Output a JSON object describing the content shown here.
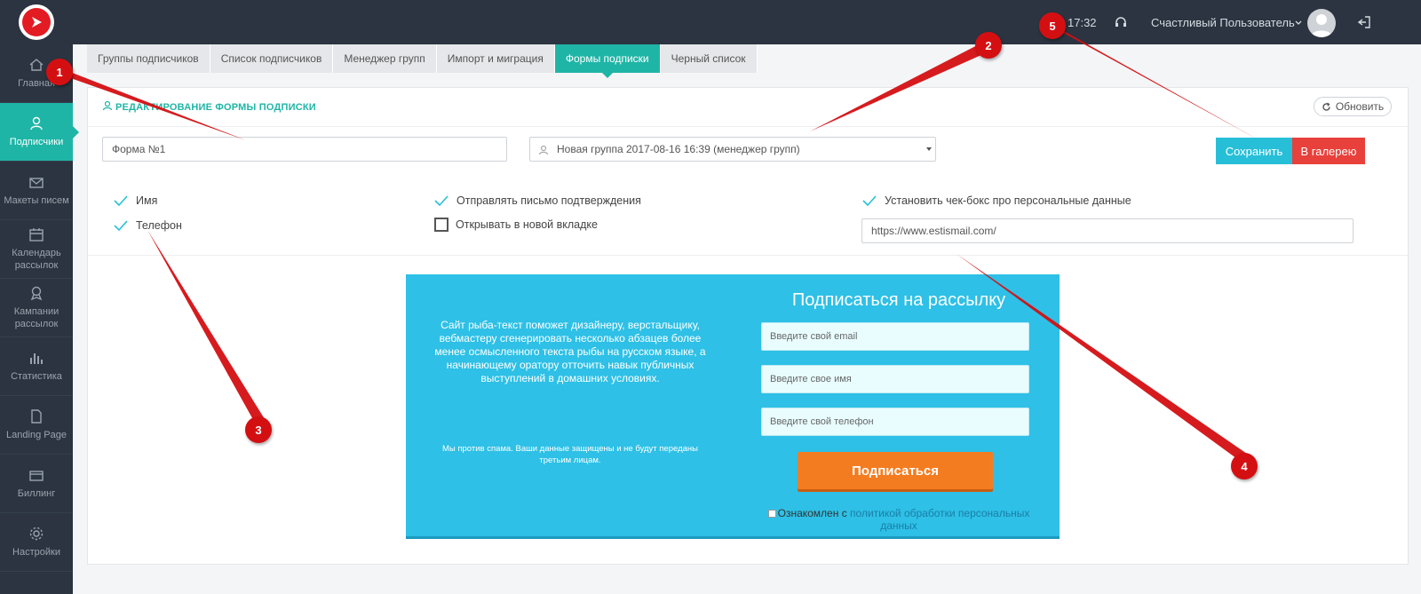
{
  "sidebar": {
    "items": [
      {
        "label": "Главная",
        "icon": "home-icon"
      },
      {
        "label": "Подписчики",
        "icon": "users-icon"
      },
      {
        "label": "Макеты писем",
        "icon": "envelope-icon"
      },
      {
        "label": "Календарь рассылок",
        "icon": "calendar-icon"
      },
      {
        "label": "Кампании рассылок",
        "icon": "campaign-icon"
      },
      {
        "label": "Статистика",
        "icon": "bar-chart-icon"
      },
      {
        "label": "Landing Page",
        "icon": "page-icon"
      },
      {
        "label": "Биллинг",
        "icon": "wallet-icon"
      },
      {
        "label": "Настройки",
        "icon": "gear-icon"
      }
    ]
  },
  "topbar": {
    "time": "17:32",
    "user_name": "Счастливый Пользователь"
  },
  "tabs": [
    {
      "label": "Группы подписчиков"
    },
    {
      "label": "Список подписчиков"
    },
    {
      "label": "Менеджер групп"
    },
    {
      "label": "Импорт и миграция"
    },
    {
      "label": "Формы подписки"
    },
    {
      "label": "Черный список"
    }
  ],
  "panel": {
    "title": "РЕДАКТИРОВАНИЕ ФОРМЫ ПОДПИСКИ",
    "refresh_label": "Обновить",
    "form_name": "Форма №1",
    "group_select": "Новая группа 2017-08-16 16:39 (менеджер групп)",
    "save_label": "Сохранить",
    "gallery_label": "В галерею",
    "options": {
      "name": "Имя",
      "phone": "Телефон",
      "send_confirmation": "Отправлять письмо подтверждения",
      "open_new_tab": "Открывать в новой вкладке",
      "personal_data_checkbox": "Установить чек-бокс про персональные данные",
      "policy_url": "https://www.estismail.com/"
    }
  },
  "preview": {
    "title": "Подписаться на рассылку",
    "description": "Сайт рыба-текст поможет дизайнеру, верстальщику, вебмастеру сгенерировать несколько абзацев более менее осмысленного текста рыбы на русском языке, а начинающему оратору отточить навык публичных выступлений в домашних условиях.",
    "spam_note": "Мы против спама. Ваши данные защищены и не будут переданы третьим лицам.",
    "email_placeholder": "Введите свой email",
    "name_placeholder": "Введите свое имя",
    "phone_placeholder": "Введите свой телефон",
    "submit_label": "Подписаться",
    "consent_prefix": "Ознакомлен с ",
    "consent_link": "политикой обработки персональных данных"
  },
  "annotations": [
    "1",
    "2",
    "3",
    "4",
    "5"
  ],
  "colors": {
    "sidebar_bg": "#2b3440",
    "accent_teal": "#1fb5a6",
    "save_blue": "#27bfd8",
    "gallery_red": "#e8403b",
    "preview_bg": "#2ec0e6",
    "submit_orange": "#f47c20",
    "annotation_red": "#d40f12"
  }
}
